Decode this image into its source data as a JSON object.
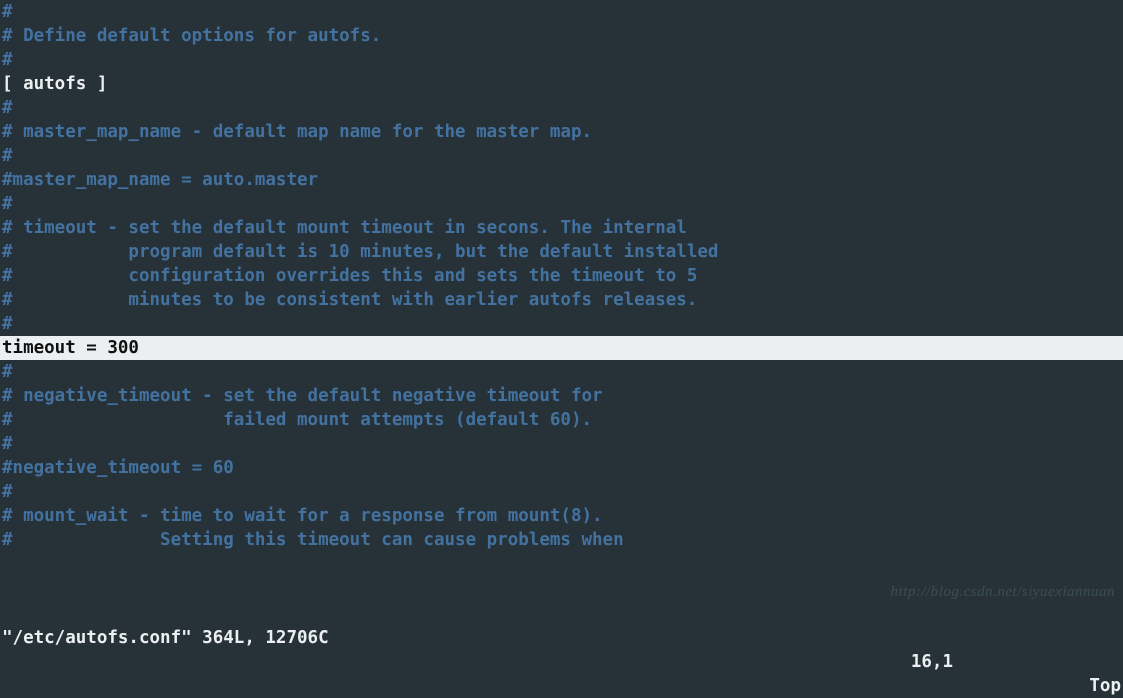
{
  "lines": [
    {
      "cls": "",
      "text": "#"
    },
    {
      "cls": "",
      "text": "# Define default options for autofs."
    },
    {
      "cls": "",
      "text": "#"
    },
    {
      "cls": "white",
      "text": "[ autofs ]"
    },
    {
      "cls": "",
      "text": "#"
    },
    {
      "cls": "",
      "text": "# master_map_name - default map name for the master map."
    },
    {
      "cls": "",
      "text": "#"
    },
    {
      "cls": "",
      "text": "#master_map_name = auto.master"
    },
    {
      "cls": "",
      "text": "#"
    },
    {
      "cls": "",
      "text": "# timeout - set the default mount timeout in secons. The internal"
    },
    {
      "cls": "",
      "text": "#           program default is 10 minutes, but the default installed"
    },
    {
      "cls": "",
      "text": "#           configuration overrides this and sets the timeout to 5"
    },
    {
      "cls": "",
      "text": "#           minutes to be consistent with earlier autofs releases."
    },
    {
      "cls": "",
      "text": "#"
    },
    {
      "cls": "cursor",
      "text": "timeout = 300"
    },
    {
      "cls": "",
      "text": "#"
    },
    {
      "cls": "",
      "text": "# negative_timeout - set the default negative timeout for"
    },
    {
      "cls": "",
      "text": "#                    failed mount attempts (default 60)."
    },
    {
      "cls": "",
      "text": "#"
    },
    {
      "cls": "",
      "text": "#negative_timeout = 60"
    },
    {
      "cls": "",
      "text": "#"
    },
    {
      "cls": "",
      "text": "# mount_wait - time to wait for a response from mount(8)."
    },
    {
      "cls": "",
      "text": "#              Setting this timeout can cause problems when"
    }
  ],
  "statusbar": {
    "filename": "\"/etc/autofs.conf\" 364L, 12706C",
    "ruler": "16,1",
    "position": "Top"
  },
  "watermark": "http://blog.csdn.net/siyuexiannuan"
}
